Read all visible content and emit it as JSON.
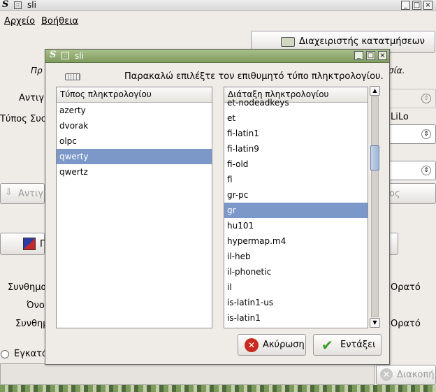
{
  "main_window": {
    "title": "sli",
    "menu": [
      "Αρχείο",
      "Βοήθεια"
    ],
    "partition_manager_button": "Διαχειριστής κατατμήσεων",
    "bg_texts": {
      "intro_left": "Πρ",
      "intro_right": "σία.",
      "copy_label": "Αντιγρ",
      "system_type_label": "Τύπος Συστ",
      "lilo_label": "LiLo",
      "copy_button": "Αντιγρ",
      "right_button": "ος",
      "left_button": "Π",
      "password_label": "Συνθημα",
      "name_label": "Όνο",
      "password2_label": "Συνθημ",
      "visible1": "Ορατό",
      "visible2": "Ορατό",
      "install_radio": "Εγκατά",
      "stop_button": "Διακοπή"
    }
  },
  "dialog": {
    "title": "sli",
    "prompt": "Παρακαλώ επιλέξτε τον επιθυμητό τύπο πληκτρολογίου.",
    "type_list": {
      "header": "Τύπος πληκτρολογίου",
      "items": [
        "azerty",
        "dvorak",
        "olpc",
        "qwerty",
        "qwertz"
      ],
      "selected": "qwerty"
    },
    "layout_list": {
      "header": "Διάταξη πληκτρολογίου",
      "items": [
        "et-nodeadkeys",
        "et",
        "fi-latin1",
        "fi-latin9",
        "fi-old",
        "fi",
        "gr-pc",
        "gr",
        "hu101",
        "hypermap.m4",
        "il-heb",
        "il-phonetic",
        "il",
        "is-latin1-us",
        "is-latin1"
      ],
      "selected": "gr"
    },
    "cancel_button": "Ακύρωση",
    "ok_button": "Εντάξει"
  }
}
